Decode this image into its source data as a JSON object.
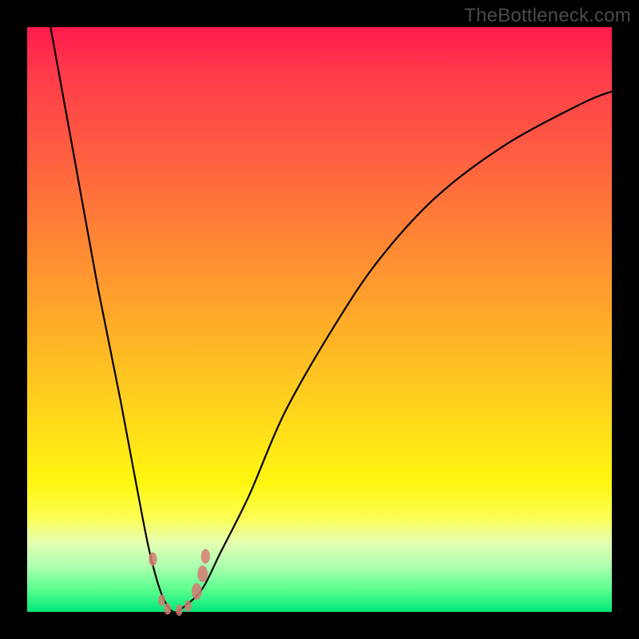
{
  "watermark": "TheBottleneck.com",
  "colors": {
    "gradient_top": "#ff1a4d",
    "gradient_bottom": "#00e878",
    "curve": "#000000",
    "marker": "#d67a72",
    "frame_bg": "#000000"
  },
  "chart_data": {
    "type": "line",
    "title": "",
    "xlabel": "",
    "ylabel": "",
    "xlim": [
      0,
      100
    ],
    "ylim": [
      0,
      100
    ],
    "grid": false,
    "legend": false,
    "note": "V-shaped bottleneck curve; y≈0 is optimal (green), y≈100 is worst (red). No numeric axis ticks are rendered in the image; x/y values are read as percent of plot area.",
    "series": [
      {
        "name": "bottleneck-curve",
        "x": [
          4,
          8,
          12,
          16,
          19,
          21,
          23,
          25,
          27,
          30,
          33,
          38,
          44,
          52,
          60,
          70,
          82,
          95,
          100
        ],
        "y": [
          100,
          78,
          56,
          36,
          20,
          10,
          3,
          0,
          1,
          4,
          10,
          20,
          34,
          48,
          60,
          71,
          80,
          87,
          89
        ]
      }
    ],
    "markers": [
      {
        "x": 21.5,
        "y": 9.0,
        "r": 1.3
      },
      {
        "x": 23.0,
        "y": 2.0,
        "r": 1.1
      },
      {
        "x": 24.0,
        "y": 0.5,
        "r": 1.1
      },
      {
        "x": 26.0,
        "y": 0.3,
        "r": 1.1
      },
      {
        "x": 27.5,
        "y": 1.0,
        "r": 1.1
      },
      {
        "x": 29.0,
        "y": 3.5,
        "r": 1.6
      },
      {
        "x": 30.0,
        "y": 6.5,
        "r": 1.6
      },
      {
        "x": 30.5,
        "y": 9.5,
        "r": 1.4
      }
    ]
  }
}
